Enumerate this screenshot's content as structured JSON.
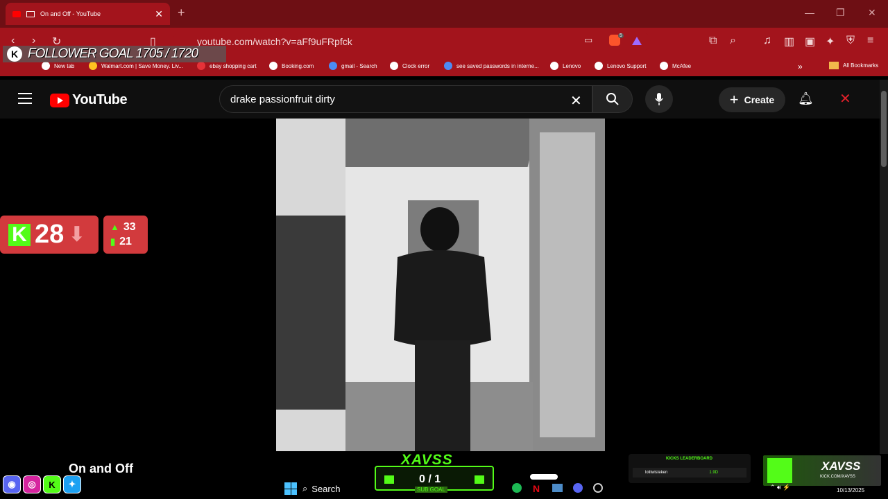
{
  "browser": {
    "tab_title": "On and Off - YouTube",
    "url": "youtube.com/watch?v=aFf9uFRpfck",
    "bookmarks": [
      "New tab",
      "Walmart.com | Save Money. Liv...",
      "ebay shopping cart",
      "Booking.com",
      "gmail - Search",
      "Clock error",
      "see saved passwords in interne...",
      "Lenovo",
      "Lenovo Support",
      "McAfee"
    ],
    "all_bookmarks": "All Bookmarks",
    "extension_badge": "5"
  },
  "youtube": {
    "logo_text": "YouTube",
    "search_query": "drake passionfruit dirty",
    "create_label": "Create",
    "video_title": "On and Off"
  },
  "overlay": {
    "follower_goal": "FOLLOWER GOAL 1705 / 1720",
    "kick_count": "28",
    "stat_up": "33",
    "stat_bars": "21",
    "sub_goal_count": "0 / 1",
    "sub_goal_label": "SUB GOAL",
    "brand": "XAVSS",
    "leaderboard_title": "KICKS LEADERBOARD",
    "leaderboard_user": "lolitwisteken",
    "leaderboard_value": "1.9D",
    "kick_url": "KICK.COM/XAVSS"
  },
  "taskbar": {
    "search_label": "Search",
    "date": "10/13/2025"
  },
  "colors": {
    "browser_red": "#a3141c",
    "kick_green": "#53fc18",
    "youtube_red": "#ff0000"
  }
}
